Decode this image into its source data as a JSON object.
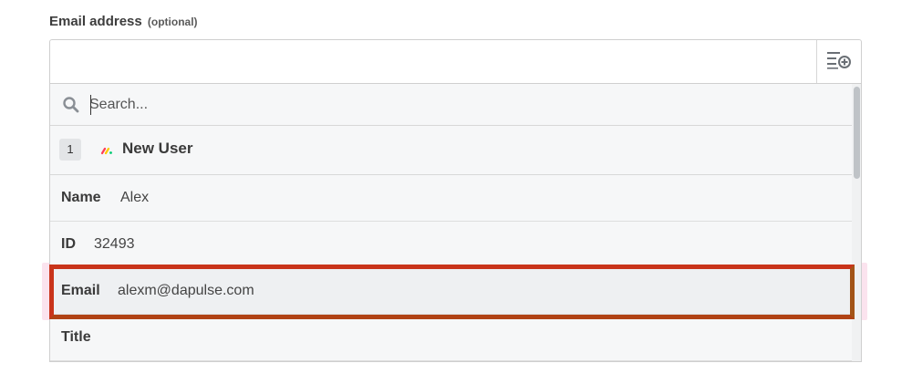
{
  "field": {
    "label": "Email address",
    "optional_tag": "(optional)",
    "value": "",
    "insert_icon": "insert-data-icon"
  },
  "dropdown": {
    "search_placeholder": "Search...",
    "search_icon": "search-icon",
    "group": {
      "step_number": "1",
      "app_icon": "monday-logo-icon",
      "title": "New User"
    },
    "rows": [
      {
        "key": "Name",
        "value": "Alex"
      },
      {
        "key": "ID",
        "value": "32493"
      },
      {
        "key": "Email",
        "value": "alexm@dapulse.com"
      },
      {
        "key": "Title",
        "value": ""
      }
    ]
  },
  "colors": {
    "highlight_border": "#c9341a",
    "highlight_glow": "#fbe3ee",
    "logo_red": "#ff3d57",
    "logo_yellow": "#ffcb00",
    "logo_green": "#00ca72"
  }
}
